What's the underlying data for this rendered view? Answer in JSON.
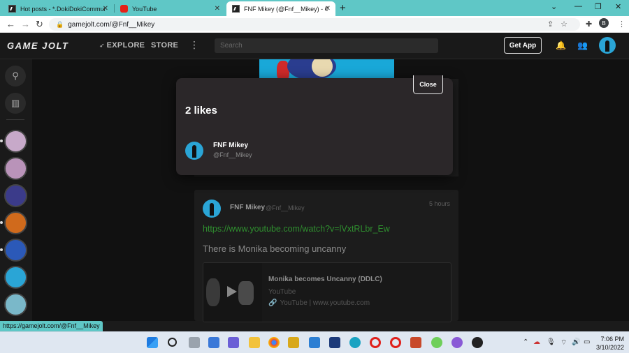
{
  "browser": {
    "tabs": [
      {
        "title": "Hot posts - *.DokiDokiCommuni",
        "favicon": "gamejolt-icon",
        "active": false
      },
      {
        "title": "YouTube",
        "favicon": "youtube-icon",
        "active": false
      },
      {
        "title": "FNF Mikey (@Fnf__Mikey) - Gam",
        "favicon": "gamejolt-icon",
        "active": true
      }
    ],
    "new_tab_label": "+",
    "url": "gamejolt.com/@Fnf__Mikey",
    "profile_initial": "B"
  },
  "header": {
    "logo": "GAME JOLT",
    "nav": {
      "explore": "EXPLORE",
      "store": "STORE"
    },
    "search_placeholder": "Search",
    "get_app": "Get App"
  },
  "hover_url": "https://gamejolt.com/@Fnf__Mikey",
  "post": {
    "author_name": "FNF Mikey",
    "author_handle": "@Fnf__Mikey",
    "time": "5 hours",
    "link": "https://www.youtube.com/watch?v=lVxtRLbr_Ew",
    "text": "There is Monika becoming uncanny",
    "embed": {
      "title": "Monika becomes Uncanny (DDLC)",
      "site": "YouTube",
      "source": "YouTube | www.youtube.com"
    }
  },
  "modal": {
    "close_label": "Close",
    "title": "2 likes",
    "likers": [
      {
        "name": "FNF Mikey",
        "handle": "@Fnf__Mikey"
      }
    ]
  },
  "taskbar": {
    "time": "7:06 PM",
    "date": "3/10/2022"
  },
  "colors": {
    "tabstrip": "#5fc7c6",
    "link_green": "#2f8f2f",
    "modal_bg": "#2b2729"
  }
}
